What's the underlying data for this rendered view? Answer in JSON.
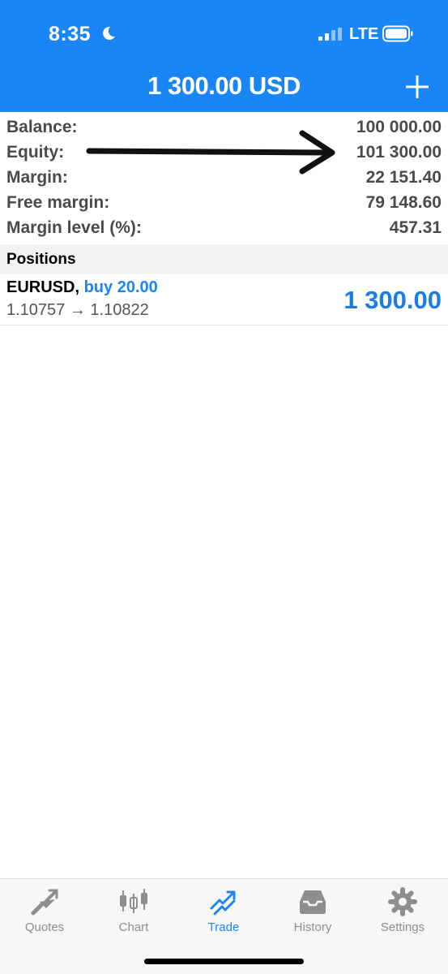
{
  "status_bar": {
    "time": "8:35",
    "network": "LTE"
  },
  "header": {
    "title": "1 300.00 USD"
  },
  "summary": [
    {
      "label": "Balance:",
      "value": "100 000.00"
    },
    {
      "label": "Equity:",
      "value": "101 300.00"
    },
    {
      "label": "Margin:",
      "value": "22 151.40"
    },
    {
      "label": "Free margin:",
      "value": "79 148.60"
    },
    {
      "label": "Margin level (%):",
      "value": "457.31"
    }
  ],
  "positions": {
    "header": "Positions",
    "items": [
      {
        "symbol": "EURUSD,",
        "side": "buy 20.00",
        "prices": "1.10757 → 1.10822",
        "profit": "1 300.00"
      }
    ]
  },
  "tabs": [
    {
      "label": "Quotes",
      "icon": "quotes-icon"
    },
    {
      "label": "Chart",
      "icon": "chart-icon"
    },
    {
      "label": "Trade",
      "icon": "trade-icon",
      "active": true
    },
    {
      "label": "History",
      "icon": "history-icon"
    },
    {
      "label": "Settings",
      "icon": "gear-icon"
    }
  ],
  "colors": {
    "accent": "#1a86f5",
    "profit": "#1a7de6",
    "label": "#4a4a4a"
  }
}
